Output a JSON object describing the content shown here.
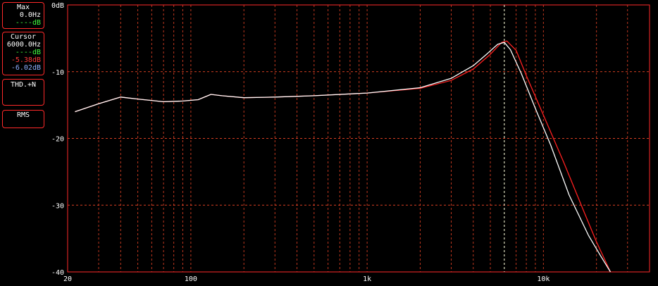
{
  "panels": {
    "max": {
      "title": "Max",
      "freq": "0.0Hz",
      "db": "----dB"
    },
    "cursor": {
      "title": "Cursor",
      "freq": "6000.0Hz",
      "db_green": "----dB",
      "db_red": "-5.38dB",
      "db_blue": "-6.02dB"
    },
    "thd": {
      "title": "THD.+N"
    },
    "rms": {
      "title": "RMS"
    }
  },
  "colors": {
    "frame": "#ff2a2a",
    "grid": "#ff4a2a",
    "trace_red": "#ff2020",
    "trace_white": "#ffffff",
    "cursor_line": "#dfffdf"
  },
  "chart_data": {
    "type": "line",
    "x_scale": "log",
    "xlim": [
      20,
      40000
    ],
    "ylim": [
      -40,
      0
    ],
    "grid": true,
    "cursor_x": 6000,
    "xticks": [
      {
        "v": 20,
        "label": "20"
      },
      {
        "v": 100,
        "label": "100"
      },
      {
        "v": 1000,
        "label": "1k"
      },
      {
        "v": 10000,
        "label": "10k"
      }
    ],
    "yticks": [
      {
        "v": 0,
        "label": "0dB"
      },
      {
        "v": -10,
        "label": "-10"
      },
      {
        "v": -20,
        "label": "-20"
      },
      {
        "v": -30,
        "label": "-30"
      },
      {
        "v": -40,
        "label": "-40"
      }
    ],
    "series": [
      {
        "color": "#ff2020",
        "x": [
          22,
          30,
          40,
          50,
          70,
          90,
          110,
          130,
          150,
          200,
          300,
          500,
          1000,
          2000,
          3000,
          4000,
          5000,
          5800,
          6200,
          7000,
          8000,
          10000,
          13000,
          17000,
          20000,
          24000
        ],
        "y": [
          -16.0,
          -14.8,
          -13.8,
          -14.1,
          -14.5,
          -14.4,
          -14.2,
          -13.4,
          -13.6,
          -13.9,
          -13.8,
          -13.6,
          -13.2,
          -12.5,
          -11.3,
          -9.6,
          -7.4,
          -5.6,
          -5.4,
          -6.8,
          -10.6,
          -16.5,
          -23.5,
          -31.0,
          -35.5,
          -40.0
        ]
      },
      {
        "color": "#ffffff",
        "x": [
          22,
          30,
          40,
          50,
          70,
          90,
          110,
          130,
          150,
          200,
          300,
          500,
          1000,
          2000,
          3000,
          4000,
          4800,
          5500,
          6000,
          6500,
          7500,
          9000,
          11000,
          14000,
          18000,
          21000,
          24000
        ],
        "y": [
          -16.0,
          -14.8,
          -13.8,
          -14.1,
          -14.5,
          -14.4,
          -14.2,
          -13.4,
          -13.6,
          -13.9,
          -13.8,
          -13.6,
          -13.2,
          -12.4,
          -11.0,
          -9.1,
          -7.3,
          -5.9,
          -5.6,
          -6.7,
          -10.3,
          -15.5,
          -21.0,
          -28.5,
          -34.5,
          -37.5,
          -40.0
        ]
      }
    ]
  }
}
